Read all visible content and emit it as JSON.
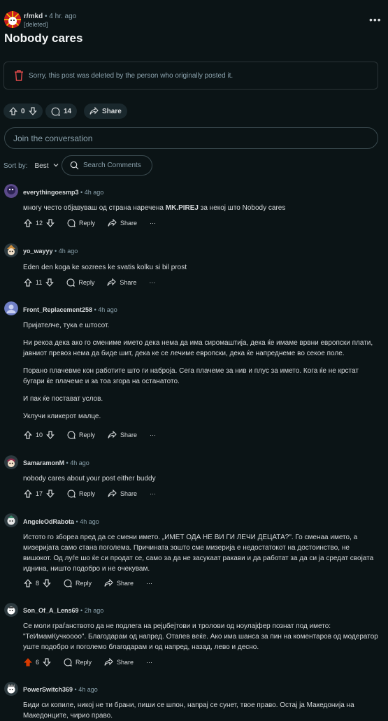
{
  "post": {
    "subreddit": "r/mkd",
    "time": "4 hr. ago",
    "author": "[deleted]",
    "title": "Nobody cares",
    "deleted_message": "Sorry, this post was deleted by the person who originally posted it.",
    "votes": "0",
    "comments": "14",
    "share": "Share"
  },
  "composer": {
    "placeholder": "Join the conversation"
  },
  "sort": {
    "label": "Sort by:",
    "value": "Best",
    "search": "Search Comments"
  },
  "labels": {
    "reply": "Reply",
    "share": "Share",
    "more": "···"
  },
  "comments": [
    {
      "author": "everythingoesmp3",
      "time": "4h ago",
      "votes": "12",
      "body_pre": "многу често објавуваш од страна наречена ",
      "body_bold": "MK.PIREJ",
      "body_post": " за некој што Nobody cares"
    },
    {
      "author": "yo_wayyy",
      "time": "4h ago",
      "votes": "11",
      "body": "Eden den koga ke sozrees ke svatis kolku si bil prost"
    },
    {
      "author": "Front_Replacement258",
      "time": "4h ago",
      "votes": "10",
      "paragraphs": [
        "Пријателче, тука е штосот.",
        "Ни рекоа дека ако го смениме името дека нема да има сиромаштија, дека ќе имаме врвни европски плати, јавниот превоз нема да биде шит, дека ке се лечиме европски, дека ќе напреднеме во секое поле.",
        "Порано плачевме кон работите што ги набројa. Сега плачеме за нив и плус за името. Кога ќе не крстат бугари ќе плачеме и за тоа згора на останатото.",
        "И пак ќе постават услов.",
        "Уклучи кликерот малце."
      ]
    },
    {
      "author": "SamaramonM",
      "time": "4h ago",
      "votes": "17",
      "body": "nobody cares about your post either buddy"
    },
    {
      "author": "AngeleOdRabota",
      "time": "4h ago",
      "votes": "8",
      "body": "Истото го збореа пред да се смени името. „ИМЕТ ОДА НЕ ВИ ГИ ЛЕЧИ ДЕЦАТА?\". Го сменаа името, а мизеријата само стана поголема. Причината зошто сме мизерија е недостатокот на достоинство, не вишокот. Од луѓе шо ќе си продат се, само за да не засукаат ракави и да работат за да си ја средат својата иднина, ништо подобро и не очекувам."
    },
    {
      "author": "Son_Of_A_Lens69",
      "time": "2h ago",
      "votes": "6",
      "body": "Се моли граѓанството да не подлега на рејџбејтови и тролови од ноулајфер познат под името: \"ТеИмамКучкоооо\". Благодарам од напред. Отапев веќе. Ако има шанса за пин на коментаров од модератор уште подобро и поголемо благодарам и од напред, назад, лево и десно."
    },
    {
      "author": "PowerSwitch369",
      "time": "4h ago",
      "body": "Биди си копиле, никој не ти брани, пиши се шпон, напрај се сунет, твое право. Остај ја Македонија на Македонците, чирио право."
    }
  ],
  "colors": {
    "background": "#0b1416",
    "upvoted": "#d93a00",
    "muted": "#8ba2ad"
  }
}
